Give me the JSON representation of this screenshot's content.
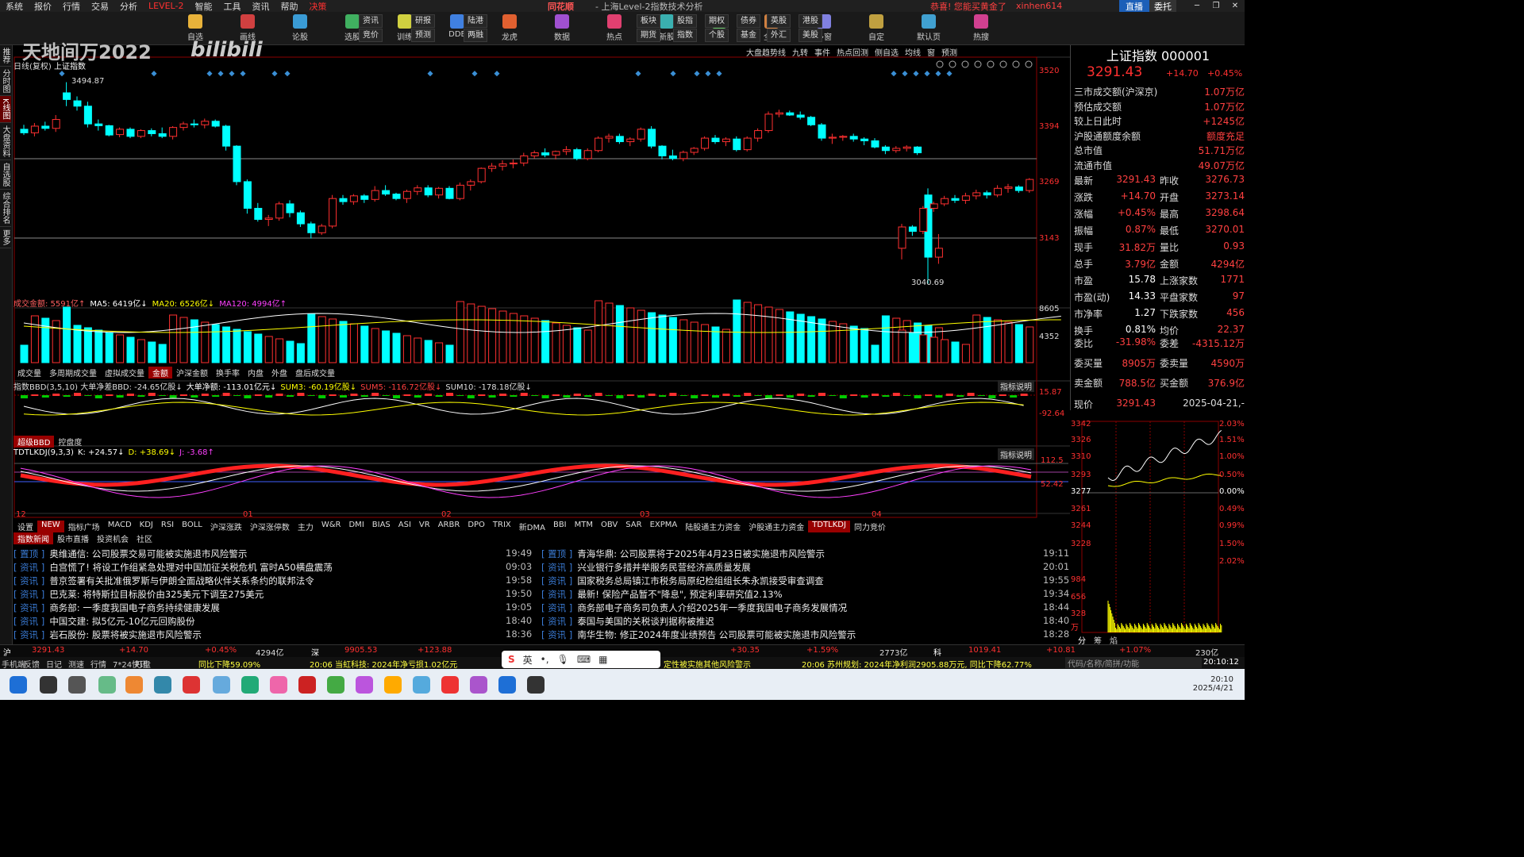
{
  "menu": {
    "items": [
      "系统",
      "报价",
      "行情",
      "交易",
      "分析"
    ],
    "level2": "LEVEL-2",
    "items2": [
      "智能",
      "工具",
      "资讯",
      "帮助"
    ],
    "decision": "决策",
    "app_title": "同花顺",
    "app_subtitle": "- 上海Level-2指数技术分析",
    "notice": "恭喜! 您能买黄金了",
    "user": "xinhen614",
    "live": "直播",
    "member": "委托"
  },
  "toolbar": {
    "buttons": [
      "资讯",
      "研报",
      "陆港",
      "板块",
      "股指",
      "期权",
      "债券",
      "英股",
      "港股"
    ],
    "buttons_b": [
      "竞价",
      "预测",
      "两融",
      "期货",
      "指数",
      "个股",
      "基金",
      "外汇",
      "美股"
    ],
    "icons": [
      "自选",
      "画线",
      "论股",
      "选股",
      "训练",
      "DDE",
      "龙虎",
      "数据",
      "热点",
      "新股",
      "创/科",
      "全球",
      "多窗",
      "自定",
      "默认页",
      "热搜"
    ]
  },
  "left_nav": [
    "推荐",
    "分时图",
    "K线图",
    "大盘资料",
    "自选股",
    "综合排名",
    "更多"
  ],
  "watermark": {
    "text": "天地间万2022",
    "brand": "bilibili"
  },
  "chart": {
    "header_right": [
      "大盘趋势线",
      "九转",
      "事件",
      "热点回测",
      "侧自选",
      "均线",
      "窗",
      "预测"
    ],
    "mode": "日线(复权)",
    "name": "上证指数",
    "price_axis": [
      "3520",
      "3394",
      "3269",
      "3143"
    ],
    "high_label": "3494.87",
    "low_label": "3040.69",
    "vol_axis": [
      "8605",
      "4352"
    ],
    "bbd_axis": [
      "15.87",
      "-92.64"
    ],
    "kdj_axis": [
      "112.5",
      "52.42"
    ],
    "months": [
      "12",
      "01",
      "02",
      "03",
      "04"
    ]
  },
  "vol_header": {
    "a": "成交金额: 5591亿↑",
    "b": "MA5: 6419亿↓",
    "c": "MA20: 6526亿↓",
    "d": "MA120: 4994亿↑"
  },
  "vol_tabs": [
    "成交量",
    "多周期成交量",
    "虚拟成交量",
    "金额",
    "沪深金额",
    "换手率",
    "内盘",
    "外盘",
    "盘后成交量"
  ],
  "bbd_header": {
    "a": "指数BBD(3,5,10) 大单净差BBD: -24.65亿股↓",
    "b": "大单净额: -113.01亿元↓",
    "c": "SUM3: -60.19亿股↓",
    "d": "SUM5: -116.72亿股↓",
    "e": "SUM10: -178.18亿股↓",
    "explain": "指标说明"
  },
  "bbd_tabs": [
    "超级BBD",
    "控盘度"
  ],
  "kdj_header": {
    "a": "TDTLKDJ(9,3,3)",
    "b": "K: +24.57↓",
    "c": "D: +38.69↓",
    "d": "J: -3.68↑",
    "explain": "指标说明"
  },
  "indicator_tabs": [
    "设置",
    "NEW",
    "指标广场",
    "MACD",
    "KDJ",
    "RSI",
    "BOLL",
    "沪深涨跌",
    "沪深涨停数",
    "主力",
    "W&R",
    "DMI",
    "BIAS",
    "ASI",
    "VR",
    "ARBR",
    "DPO",
    "TRIX",
    "新DMA",
    "BBI",
    "MTM",
    "OBV",
    "SAR",
    "EXPMA",
    "陆股通主力资金",
    "沪股通主力资金",
    "TDTLKDJ",
    "同力竞价"
  ],
  "news_tabs": [
    "指数新闻",
    "股市直播",
    "投资机会",
    "社区"
  ],
  "news_left": [
    {
      "tag": "置顶",
      "txt": "奥维通信: 公司股票交易可能被实施退市风险警示",
      "time": "19:49"
    },
    {
      "tag": "资讯",
      "txt": "白宫慌了! 将设工作组紧急处理对中国加征关税危机 富时A50横盘震荡",
      "time": "09:03"
    },
    {
      "tag": "资讯",
      "txt": "普京签署有关批准俄罗斯与伊朗全面战略伙伴关系条约的联邦法令",
      "time": "19:58"
    },
    {
      "tag": "资讯",
      "txt": "巴克莱: 将特斯拉目标股价由325美元下调至275美元",
      "time": "19:50"
    },
    {
      "tag": "资讯",
      "txt": "商务部: 一季度我国电子商务持续健康发展",
      "time": "19:05"
    },
    {
      "tag": "资讯",
      "txt": "中国交建: 拟5亿元-10亿元回购股份",
      "time": "18:40"
    },
    {
      "tag": "资讯",
      "txt": "岩石股份: 股票将被实施退市风险警示",
      "time": "18:36"
    }
  ],
  "news_right": [
    {
      "tag": "置顶",
      "txt": "青海华鼎: 公司股票将于2025年4月23日被实施退市风险警示",
      "time": "19:11"
    },
    {
      "tag": "资讯",
      "txt": "兴业银行多措并举服务民营经济高质量发展",
      "time": "20:01"
    },
    {
      "tag": "资讯",
      "txt": "国家税务总局镇江市税务局原纪检组组长朱永凯接受审查调查",
      "time": "19:55"
    },
    {
      "tag": "资讯",
      "txt": "最新! 保险产品暂不\"降息\", 预定利率研究值2.13%",
      "time": "19:34"
    },
    {
      "tag": "资讯",
      "txt": "商务部电子商务司负责人介绍2025年一季度我国电子商务发展情况",
      "time": "18:44"
    },
    {
      "tag": "资讯",
      "txt": "泰国与美国的关税谈判据称被推迟",
      "time": "18:40"
    },
    {
      "tag": "资讯",
      "txt": "南华生物: 修正2024年度业绩预告 公司股票可能被实施退市风险警示",
      "time": "18:28"
    }
  ],
  "panel": {
    "title": "上证指数 000001",
    "price": "3291.43",
    "change": "+14.70",
    "pct": "+0.45%",
    "rows1": [
      [
        "三市成交额(沪深京)",
        "1.07万亿"
      ],
      [
        "预估成交额",
        "1.07万亿"
      ],
      [
        "较上日此时",
        "+1245亿"
      ],
      [
        "沪股通额度余额",
        "额度充足"
      ],
      [
        "总市值",
        "51.71万亿"
      ],
      [
        "流通市值",
        "49.07万亿"
      ]
    ],
    "rows2": [
      [
        "最新",
        "3291.43",
        "昨收",
        "3276.73"
      ],
      [
        "涨跌",
        "+14.70",
        "开盘",
        "3273.14"
      ],
      [
        "涨幅",
        "+0.45%",
        "最高",
        "3298.64"
      ],
      [
        "振幅",
        "0.87%",
        "最低",
        "3270.01"
      ],
      [
        "现手",
        "31.82万",
        "量比",
        "0.93"
      ],
      [
        "总手",
        "3.79亿",
        "金额",
        "4294亿"
      ],
      [
        "市盈",
        "15.78",
        "上涨家数",
        "1771"
      ],
      [
        "市盈(动)",
        "14.33",
        "平盘家数",
        "97"
      ],
      [
        "市净率",
        "1.27",
        "下跌家数",
        "456"
      ],
      [
        "换手",
        "0.81%",
        "均价",
        "22.37"
      ]
    ],
    "rows3": [
      [
        "委比",
        "-31.98%",
        "委差",
        "-4315.12万"
      ],
      [
        "委买量",
        "8905万",
        "委卖量",
        "4590万"
      ],
      [
        "卖金额",
        "788.5亿",
        "买金额",
        "376.9亿"
      ]
    ],
    "xianjia": "现价",
    "xianjia_v": "3291.43",
    "date": "2025-04-21,-",
    "mini_left": [
      "3342",
      "3326",
      "3310",
      "3293",
      "3277",
      "3261",
      "3244",
      "3228",
      "984",
      "656",
      "328",
      "万"
    ],
    "mini_right": [
      "2.03%",
      "1.51%",
      "1.00%",
      "0.50%",
      "0.00%",
      "0.49%",
      "0.99%",
      "1.50%",
      "2.02%"
    ],
    "mini_tabs": [
      "分",
      "筹",
      "焰"
    ]
  },
  "status": {
    "sh": "沪",
    "sh_p": "3291.43",
    "sh_c": "+14.70",
    "sh_pct": "+0.45%",
    "sh_amt": "4294亿",
    "sz": "深",
    "sz_p": "9905.53",
    "sz_c": "+123.88",
    "sz_pct": "+1.59%",
    "sz_amt": "",
    "c_p": "+30.35",
    "c_amt": "2773亿",
    "kc": "科",
    "kc_p": "1019.41",
    "kc_c": "+10.81",
    "kc_pct": "+1.07%",
    "kc_amt": "230亿"
  },
  "status2": {
    "left": [
      "手机端",
      "反馈",
      "日记",
      "测速",
      "行情",
      "7*24快讯",
      "盯盘"
    ],
    "t1": "同比下降59.09%",
    "t2": "20:06 当虹科技: 2024年净亏损1.02亿元",
    "t3": "定性被实施其他风险警示",
    "t4": "20:06 苏州规划: 2024年净利润2905.88万元, 同比下降62.77%",
    "search": "代码/名称/简拼/功能",
    "clock": "20:10:12"
  },
  "ime": [
    "英",
    "设置"
  ],
  "taskbar": {
    "time": "20:10",
    "date": "2025/4/21"
  },
  "colors": {
    "up": "#ff3030",
    "down": "#00ffff",
    "bg": "#000000"
  }
}
